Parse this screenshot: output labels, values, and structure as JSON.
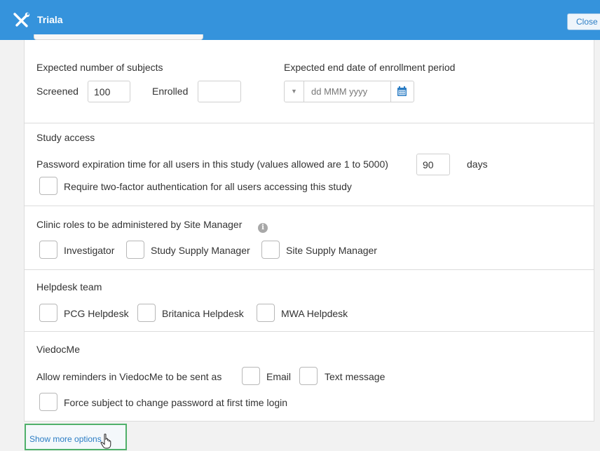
{
  "app": {
    "title": "Triala",
    "close_label": "Close"
  },
  "enrollment": {
    "subjects_label": "Expected number of subjects",
    "screened_label": "Screened",
    "screened_value": "100",
    "enrolled_label": "Enrolled",
    "enrolled_value": "",
    "end_date_label": "Expected end date of enrollment period",
    "end_date_placeholder": "dd MMM yyyy"
  },
  "study_access": {
    "title": "Study access",
    "password_label": "Password expiration time for all users in this study (values allowed are 1 to 5000)",
    "password_value": "90",
    "days_label": "days",
    "two_factor_label": "Require two-factor authentication for all users accessing this study"
  },
  "clinic_roles": {
    "title": "Clinic roles to be administered by Site Manager",
    "options": [
      "Investigator",
      "Study Supply Manager",
      "Site Supply Manager"
    ]
  },
  "helpdesk": {
    "title": "Helpdesk team",
    "options": [
      "PCG Helpdesk",
      "Britanica Helpdesk",
      "MWA Helpdesk"
    ]
  },
  "viedocme": {
    "title": "ViedocMe",
    "reminders_label": "Allow reminders in ViedocMe to be sent as",
    "options": [
      "Email",
      "Text message"
    ],
    "force_password_label": "Force subject to change password at first time login"
  },
  "show_more_label": "Show more options",
  "colors": {
    "header": "#3593dc",
    "link": "#2b7dc4",
    "highlight": "#4fb06a"
  }
}
